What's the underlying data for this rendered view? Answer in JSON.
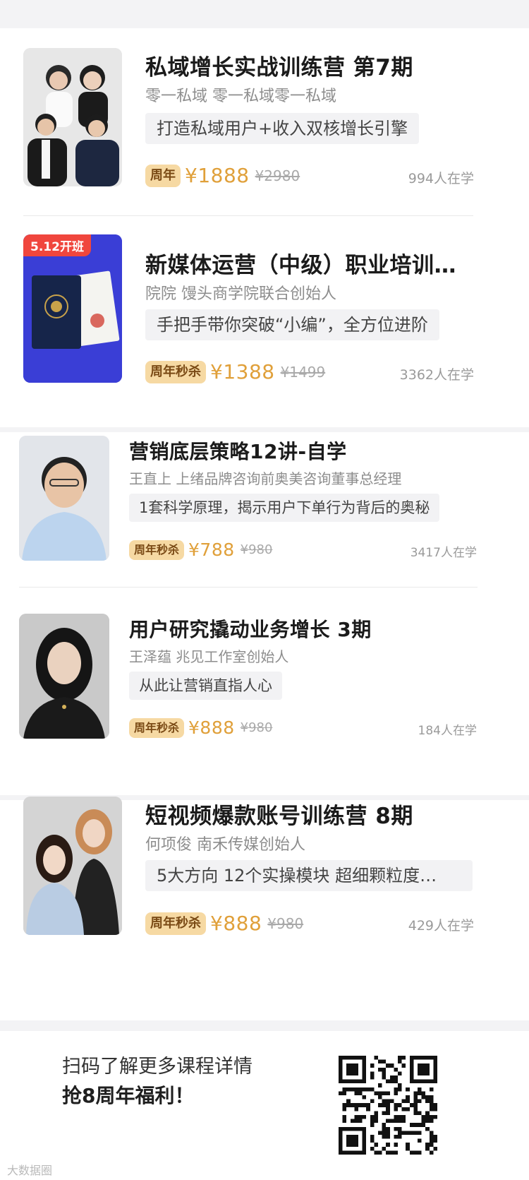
{
  "courses": [
    {
      "title": "私域增长实战训练营 第7期",
      "author": "零一私域 零一私域零一私域",
      "slogan": "打造私域用户+收入双核增长引擎",
      "badge": "周年",
      "price": "¥1888",
      "orig": "¥2980",
      "learners": "994人在学",
      "ribbon": ""
    },
    {
      "title": "新媒体运营（中级）职业培训…",
      "author": "院院 馒头商学院联合创始人",
      "slogan": "手把手带你突破“小编”，全方位进阶",
      "badge": "周年秒杀",
      "price": "¥1388",
      "orig": "¥1499",
      "learners": "3362人在学",
      "ribbon": "5.12开班"
    },
    {
      "title": "营销底层策略12讲-自学",
      "author": "王直上 上绪品牌咨询前奥美咨询董事总经理",
      "slogan": "1套科学原理，揭示用户下单行为背后的奥秘",
      "badge": "周年秒杀",
      "price": "¥788",
      "orig": "¥980",
      "learners": "3417人在学",
      "ribbon": ""
    },
    {
      "title": "用户研究撬动业务增长 3期",
      "author": "王泽蕴 兆见工作室创始人",
      "slogan": "从此让营销直指人心",
      "badge": "周年秒杀",
      "price": "¥888",
      "orig": "¥980",
      "learners": "184人在学",
      "ribbon": ""
    },
    {
      "title": "短视频爆款账号训练营 8期",
      "author": "何项俊 南禾传媒创始人",
      "slogan": "5大方向 12个实操模块 超细颗粒度…",
      "badge": "周年秒杀",
      "price": "¥888",
      "orig": "¥980",
      "learners": "429人在学",
      "ribbon": ""
    }
  ],
  "footer": {
    "line1": "扫码了解更多课程详情",
    "line2": "抢8周年福利！",
    "watermark": "大数据圈"
  },
  "colors": {
    "accent": "#e0a03a",
    "badge_bg": "#f6d9a3",
    "ribbon": "#f0463d"
  }
}
